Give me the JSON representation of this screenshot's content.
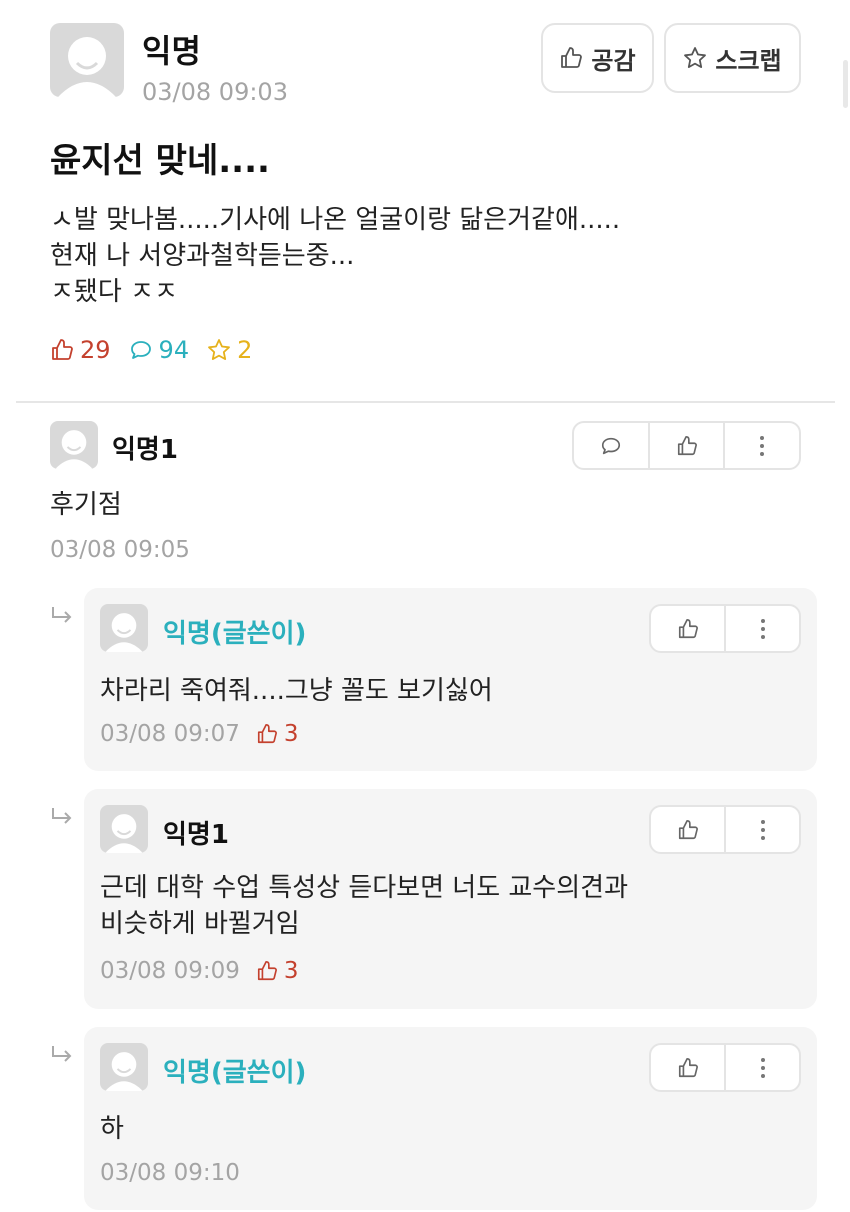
{
  "post": {
    "author": "익명",
    "time": "03/08 09:03",
    "like_button_label": "공감",
    "scrap_button_label": "스크랩",
    "title": "윤지선 맞네....",
    "body_lines": [
      "ㅅ발 맞나봄.....기사에 나온 얼굴이랑 닮은거같애.....",
      "현재 나 서양과철학듣는중...",
      "ㅈ됐다 ㅈㅈ"
    ],
    "stats": {
      "likes": "29",
      "comments": "94",
      "scraps": "2"
    }
  },
  "comments": [
    {
      "author": "익명1",
      "text": "후기점",
      "time": "03/08 09:05",
      "replies": [
        {
          "author": "익명(글쓴이)",
          "text_lines": [
            "차라리 죽여줘....그냥 꼴도 보기싫어"
          ],
          "time": "03/08 09:07",
          "likes": "3"
        },
        {
          "author": "익명1",
          "text_lines": [
            "근데 대학 수업 특성상 듣다보면 너도 교수의견과",
            "비슷하게 바뀔거임"
          ],
          "time": "03/08 09:09",
          "likes": "3"
        },
        {
          "author": "익명(글쓴이)",
          "text_lines": [
            "하"
          ],
          "time": "03/08 09:10",
          "likes": ""
        }
      ]
    }
  ],
  "colors": {
    "author_op": "#2bb0bd",
    "like": "#c4412e",
    "comment": "#2bb0bd",
    "scrap": "#e6b21c",
    "meta": "#a4a4a4"
  }
}
